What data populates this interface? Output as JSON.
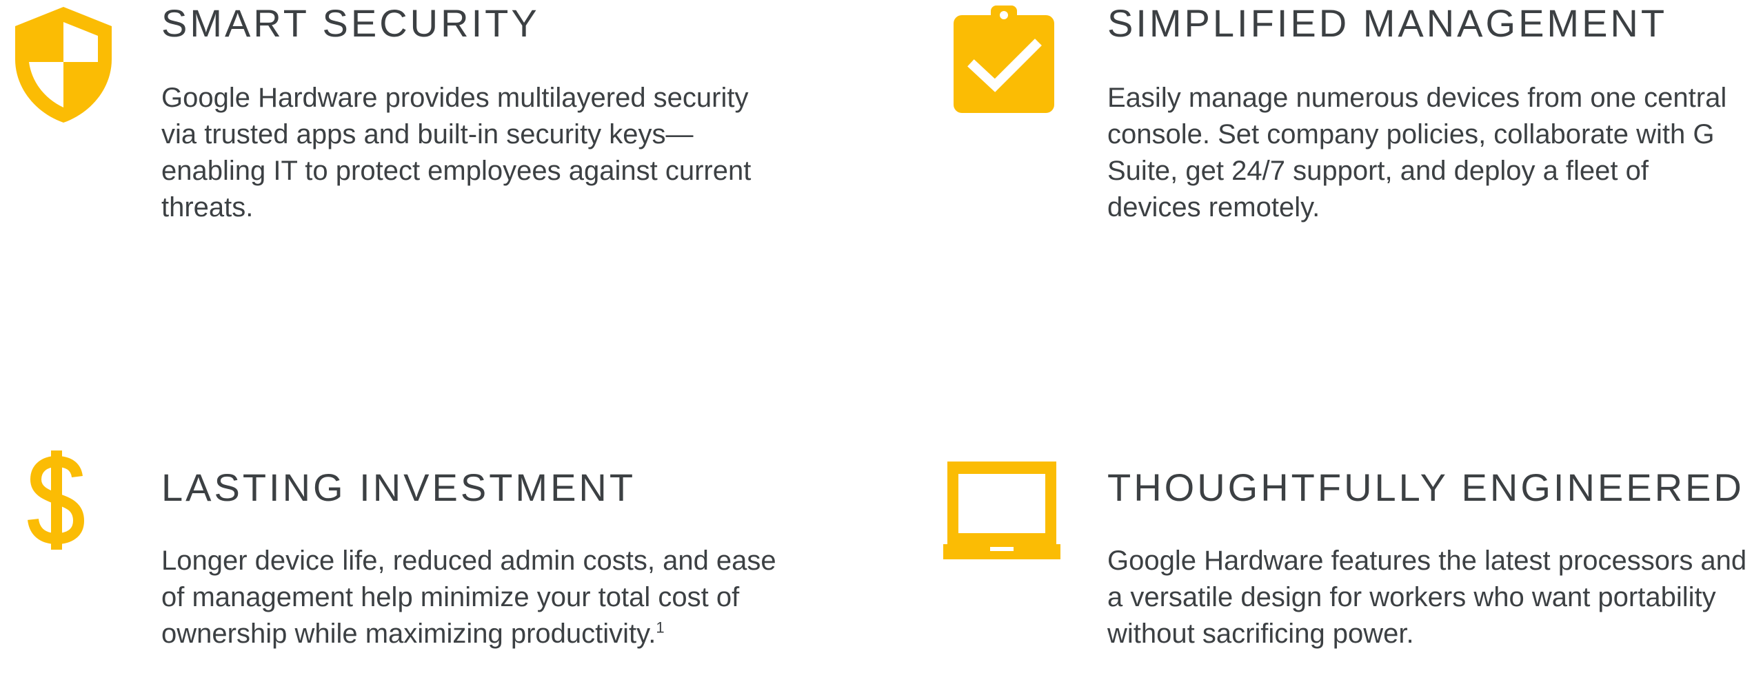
{
  "accent_color": "#fbbc04",
  "features": [
    {
      "icon": "shield-icon",
      "title": "SMART SECURITY",
      "description": "Google Hardware provides multilayered security via trusted apps and built-in security keys—enabling IT to protect employees against current threats."
    },
    {
      "icon": "clipboard-check-icon",
      "title": "SIMPLIFIED MANAGEMENT",
      "description": "Easily manage numerous devices from one central console. Set company policies, collaborate with G Suite, get 24/7 support, and deploy a fleet of devices remotely."
    },
    {
      "icon": "dollar-icon",
      "title": "LASTING INVESTMENT",
      "description": "Longer device life, reduced admin costs, and ease of management help minimize your total cost of ownership while maximizing productivity.",
      "footnote": "1"
    },
    {
      "icon": "laptop-icon",
      "title": "THOUGHTFULLY ENGINEERED",
      "description": "Google Hardware features the latest processors and a versatile design for workers who want portability without sacrificing power."
    }
  ]
}
